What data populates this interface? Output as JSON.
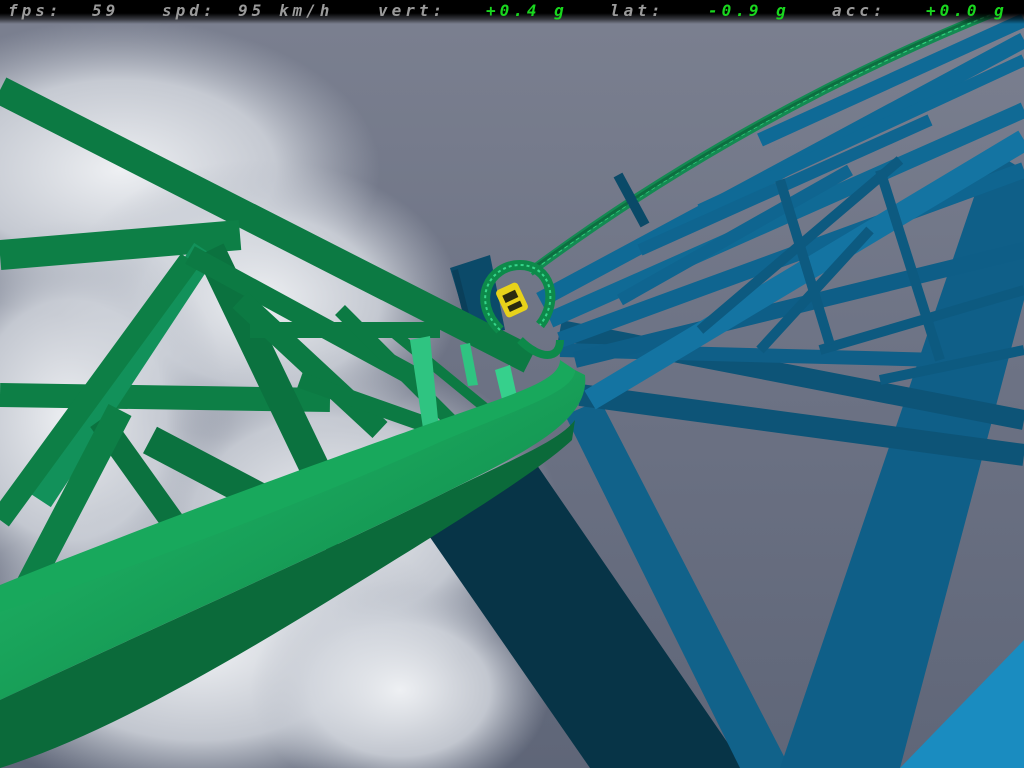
{
  "hud": {
    "fps_label": "fps:",
    "fps_value": "59",
    "spd_label": "spd:",
    "spd_value": "95 km/h",
    "vert_label": "vert:",
    "vert_value": "+0.4 g",
    "lat_label": "lat:",
    "lat_value": "-0.9 g",
    "acc_label": "acc:",
    "acc_value": "+0.0 g"
  },
  "colors": {
    "hud_text": "#9a9a9a",
    "gforce_text": "#19d61e",
    "track_green": "#0f8a4c",
    "track_green_light": "#1cb864",
    "support_blue": "#0f6086",
    "support_blue_light": "#1886b6",
    "support_dark": "#073447",
    "sky": "#6f7586",
    "cloud": "#d8dce2",
    "train_yellow": "#e8d21a"
  },
  "scene": {
    "objects": [
      "sky",
      "clouds",
      "green-track-structure",
      "blue-support-tower",
      "coaster-train",
      "distant-lattice-track"
    ]
  }
}
